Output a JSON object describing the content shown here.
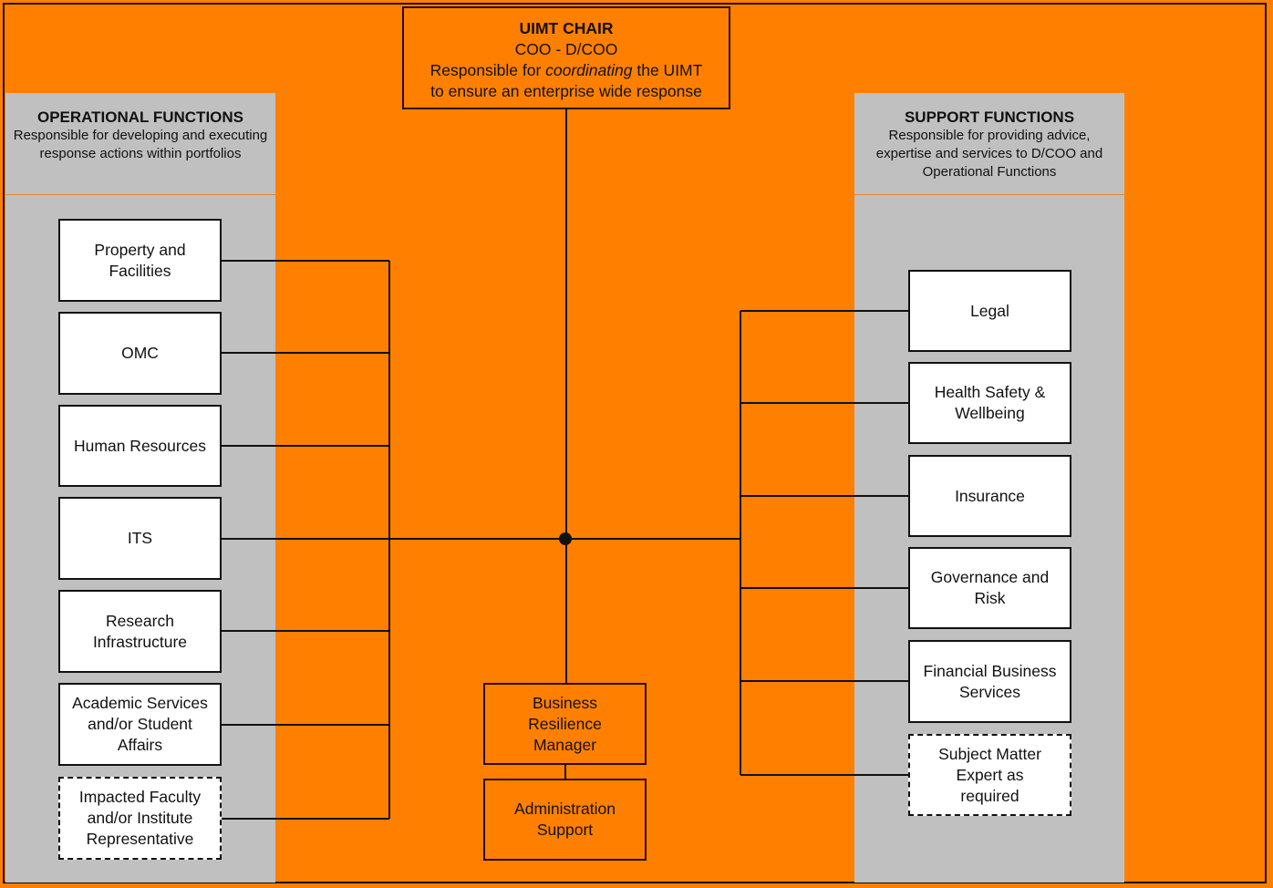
{
  "colors": {
    "background": "#FF8000",
    "panel": "#C0C0C0",
    "line": "#111111",
    "box": "#FFFFFF"
  },
  "chair": {
    "title": "UIMT CHAIR",
    "subtitle": "COO - D/COO",
    "desc_pre": "Responsible for ",
    "desc_em": "coordinating",
    "desc_post": " the UIMT",
    "desc_line2": "to ensure an enterprise wide response"
  },
  "operational": {
    "title": "OPERATIONAL FUNCTIONS",
    "description": "Responsible for developing and executing response actions within portfolios",
    "items": [
      {
        "label": "Property and Facilities",
        "style": "solid"
      },
      {
        "label": "OMC",
        "style": "solid"
      },
      {
        "label": "Human Resources",
        "style": "solid"
      },
      {
        "label": "ITS",
        "style": "solid"
      },
      {
        "label": "Research Infrastructure",
        "style": "solid"
      },
      {
        "label": "Academic Services and/or Student Affairs",
        "style": "solid"
      },
      {
        "label": "Impacted Faculty and/or Institute Representative",
        "style": "dashed"
      }
    ]
  },
  "support": {
    "title": "SUPPORT FUNCTIONS",
    "description": "Responsible for providing advice, expertise and services to D/COO and Operational Functions",
    "items": [
      {
        "label": "Legal",
        "style": "solid"
      },
      {
        "label": "Health Safety & Wellbeing",
        "style": "solid"
      },
      {
        "label": "Insurance",
        "style": "solid"
      },
      {
        "label": "Governance and Risk",
        "style": "solid"
      },
      {
        "label": "Financial Business Services",
        "style": "solid"
      },
      {
        "label": "Subject Matter Expert as required",
        "style": "dashed"
      }
    ]
  },
  "center": {
    "items": [
      {
        "label": "Business Resilience Manager"
      },
      {
        "label": "Administration Support"
      }
    ]
  }
}
